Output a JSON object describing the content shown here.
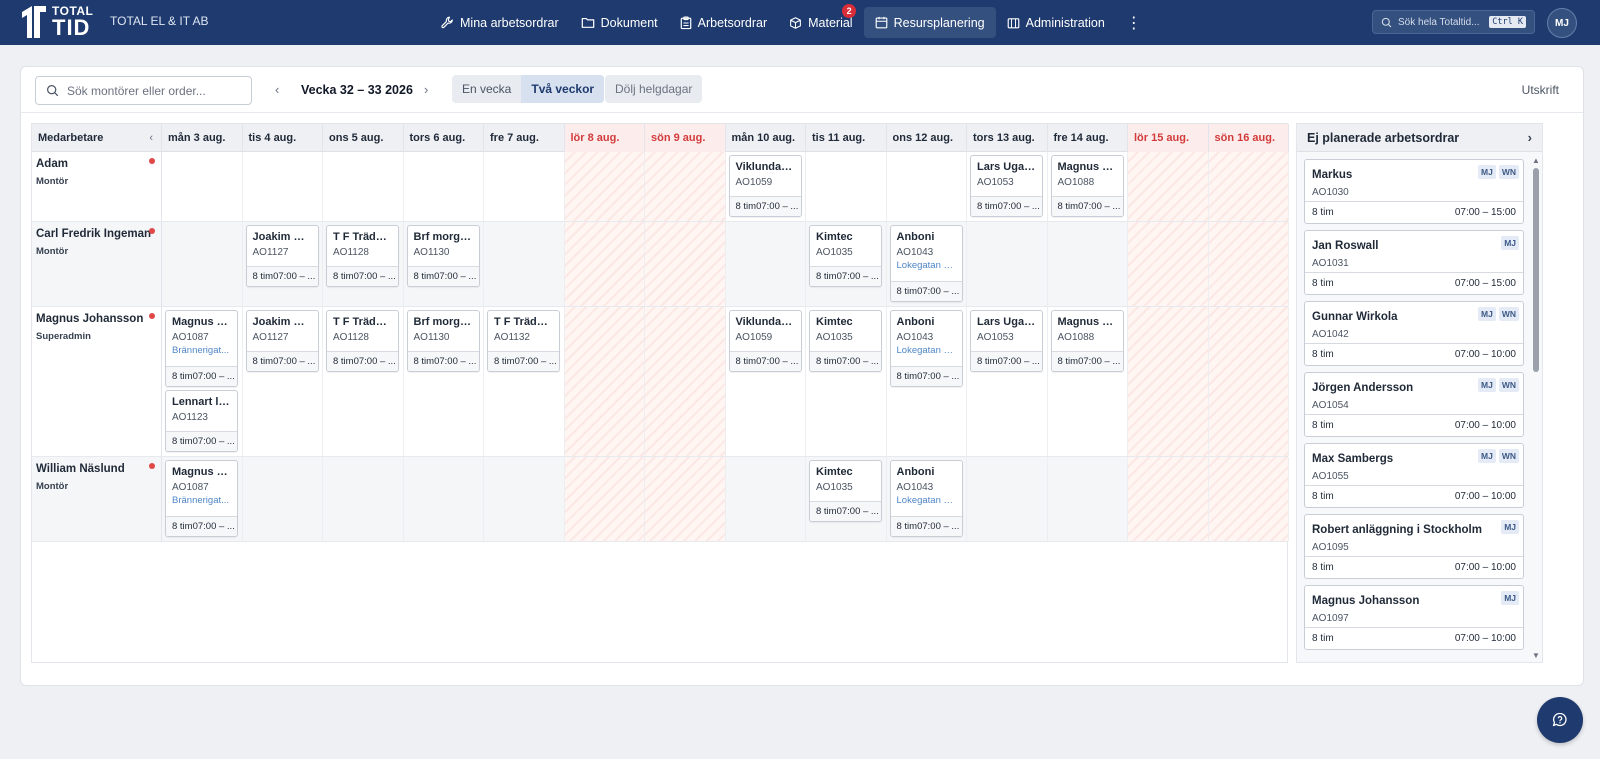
{
  "app": {
    "logo_line1": "TOTAL",
    "logo_line2": "TID",
    "company": "TOTAL EL & IT AB",
    "avatar": "MJ"
  },
  "nav": {
    "items": [
      {
        "label": "Mina arbetsordrar",
        "icon": "wrench-icon"
      },
      {
        "label": "Dokument",
        "icon": "folder-icon"
      },
      {
        "label": "Arbetsordrar",
        "icon": "clipboard-icon"
      },
      {
        "label": "Material",
        "icon": "box-icon",
        "badge": "2"
      },
      {
        "label": "Resursplanering",
        "icon": "calendar-icon",
        "active": true
      },
      {
        "label": "Administration",
        "icon": "building-icon"
      }
    ],
    "more": "⋮"
  },
  "global_search": {
    "placeholder": "Sök hela Totaltid...",
    "shortcut": "Ctrl K"
  },
  "toolbar": {
    "search_placeholder": "Sök montörer eller order...",
    "week_label": "Vecka 32 – 33 2026",
    "prev": "‹",
    "next": "›",
    "view_one_week": "En vecka",
    "view_two_weeks": "Två veckor",
    "hide_holidays": "Dölj helgdagar",
    "print": "Utskrift"
  },
  "grid": {
    "employee_header": "Medarbetare",
    "collapse": "‹",
    "days": [
      {
        "label": "mån 3 aug.",
        "weekend": false
      },
      {
        "label": "tis 4 aug.",
        "weekend": false
      },
      {
        "label": "ons 5 aug.",
        "weekend": false
      },
      {
        "label": "tors 6 aug.",
        "weekend": false
      },
      {
        "label": "fre 7 aug.",
        "weekend": false
      },
      {
        "label": "lör 8 aug.",
        "weekend": true
      },
      {
        "label": "sön 9 aug.",
        "weekend": true
      },
      {
        "label": "mån 10 aug.",
        "weekend": false
      },
      {
        "label": "tis 11 aug.",
        "weekend": false
      },
      {
        "label": "ons 12 aug.",
        "weekend": false
      },
      {
        "label": "tors 13 aug.",
        "weekend": false
      },
      {
        "label": "fre 14 aug.",
        "weekend": false
      },
      {
        "label": "lör 15 aug.",
        "weekend": true
      },
      {
        "label": "sön 16 aug.",
        "weekend": true
      }
    ],
    "rows": [
      {
        "name": "Adam",
        "role": "Montör",
        "jobs": [
          {
            "day": 7,
            "slot": 0,
            "title": "Viklunda g...",
            "code": "AO1059",
            "footer": "8 tim07:00 – ..."
          },
          {
            "day": 10,
            "slot": 0,
            "title": "Lars Ugan...",
            "code": "AO1053",
            "footer": "8 tim07:00 – ..."
          },
          {
            "day": 11,
            "slot": 0,
            "title": "Magnus Jo...",
            "code": "AO1088",
            "footer": "8 tim07:00 – ..."
          }
        ]
      },
      {
        "name": "Carl Fredrik Ingeman",
        "role": "Montör",
        "jobs": [
          {
            "day": 1,
            "slot": 0,
            "title": "Joakim Qu...",
            "code": "AO1127",
            "footer": "8 tim07:00 – ..."
          },
          {
            "day": 2,
            "slot": 0,
            "title": "T F Trädgå...",
            "code": "AO1128",
            "footer": "8 tim07:00 – ..."
          },
          {
            "day": 3,
            "slot": 0,
            "title": "Brf morgo...",
            "code": "AO1130",
            "footer": "8 tim07:00 – ..."
          },
          {
            "day": 8,
            "slot": 0,
            "title": "Kimtec",
            "code": "AO1035",
            "footer": "8 tim07:00 – ..."
          },
          {
            "day": 9,
            "slot": 0,
            "title": "Anboni",
            "code": "AO1043",
            "address": "Lokegatan 5...",
            "footer": "8 tim07:00 – ..."
          }
        ]
      },
      {
        "name": "Magnus Johansson",
        "role": "Superadmin",
        "jobs": [
          {
            "day": 0,
            "slot": 0,
            "title": "Magnus Jo...",
            "code": "AO1087",
            "address": "Brännerigat...",
            "footer": "8 tim07:00 – ..."
          },
          {
            "day": 0,
            "slot": 1,
            "title": "Lennart löf...",
            "code": "AO1123",
            "footer": "8 tim07:00 – ..."
          },
          {
            "day": 1,
            "slot": 0,
            "title": "Joakim Qu...",
            "code": "AO1127",
            "footer": "8 tim07:00 – ..."
          },
          {
            "day": 2,
            "slot": 0,
            "title": "T F Trädgå...",
            "code": "AO1128",
            "footer": "8 tim07:00 – ..."
          },
          {
            "day": 3,
            "slot": 0,
            "title": "Brf morgo...",
            "code": "AO1130",
            "footer": "8 tim07:00 – ..."
          },
          {
            "day": 4,
            "slot": 0,
            "title": "T F Trädgå...",
            "code": "AO1132",
            "footer": "8 tim07:00 – ..."
          },
          {
            "day": 7,
            "slot": 0,
            "title": "Viklunda g...",
            "code": "AO1059",
            "footer": "8 tim07:00 – ..."
          },
          {
            "day": 8,
            "slot": 0,
            "title": "Kimtec",
            "code": "AO1035",
            "footer": "8 tim07:00 – ..."
          },
          {
            "day": 9,
            "slot": 0,
            "title": "Anboni",
            "code": "AO1043",
            "address": "Lokegatan 5...",
            "footer": "8 tim07:00 – ..."
          },
          {
            "day": 10,
            "slot": 0,
            "title": "Lars Ugan...",
            "code": "AO1053",
            "footer": "8 tim07:00 – ..."
          },
          {
            "day": 11,
            "slot": 0,
            "title": "Magnus Jo...",
            "code": "AO1088",
            "footer": "8 tim07:00 – ..."
          }
        ]
      },
      {
        "name": "William Näslund",
        "role": "Montör",
        "jobs": [
          {
            "day": 0,
            "slot": 0,
            "title": "Magnus Jo...",
            "code": "AO1087",
            "address": "Brännerigat...",
            "footer": "8 tim07:00 – ..."
          },
          {
            "day": 8,
            "slot": 0,
            "title": "Kimtec",
            "code": "AO1035",
            "footer": "8 tim07:00 – ..."
          },
          {
            "day": 9,
            "slot": 0,
            "title": "Anboni",
            "code": "AO1043",
            "address": "Lokegatan 5...",
            "footer": "8 tim07:00 – ..."
          }
        ]
      }
    ]
  },
  "unplanned": {
    "title": "Ej planerade arbetsordrar",
    "chevron": "›",
    "cards": [
      {
        "title": "Markus",
        "code": "AO1030",
        "tags": [
          "MJ",
          "WN"
        ],
        "hours": "8 tim",
        "time": "07:00 – 15:00"
      },
      {
        "title": "Jan Roswall",
        "code": "AO1031",
        "tags": [
          "MJ"
        ],
        "hours": "8 tim",
        "time": "07:00 – 15:00"
      },
      {
        "title": "Gunnar Wirkola",
        "code": "AO1042",
        "tags": [
          "MJ",
          "WN"
        ],
        "hours": "8 tim",
        "time": "07:00 – 10:00"
      },
      {
        "title": "Jörgen Andersson",
        "code": "AO1054",
        "tags": [
          "MJ",
          "WN"
        ],
        "hours": "8 tim",
        "time": "07:00 – 10:00"
      },
      {
        "title": "Max Sambergs",
        "code": "AO1055",
        "tags": [
          "MJ",
          "WN"
        ],
        "hours": "8 tim",
        "time": "07:00 – 10:00"
      },
      {
        "title": "Robert anläggning i Stockholm",
        "code": "AO1095",
        "tags": [
          "MJ"
        ],
        "hours": "8 tim",
        "time": "07:00 – 10:00"
      },
      {
        "title": "Magnus Johansson",
        "code": "AO1097",
        "tags": [
          "MJ"
        ],
        "hours": "8 tim",
        "time": "07:00 – 10:00"
      }
    ]
  },
  "colors": {
    "topbar": "#1e3a6e",
    "weekend_text": "#d23b3b",
    "link": "#4f86c6"
  }
}
